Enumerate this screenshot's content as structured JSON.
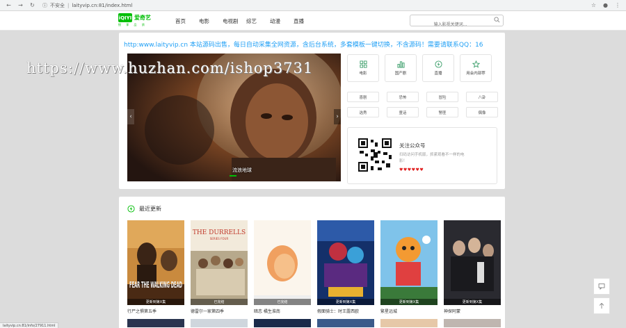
{
  "browser": {
    "insecure_label": "不安全",
    "separator": "|",
    "url": "laityvip.cn:81/index.html"
  },
  "header": {
    "logo_box": "iQIYI",
    "logo_text": "爱奇艺",
    "logo_sub": "悦 享 品 质",
    "nav": [
      "首页",
      "电影",
      "电视剧",
      "综艺",
      "动漫",
      "直播"
    ],
    "search_placeholder": "输入影视关键词...",
    "accent_color": "#00be06"
  },
  "marquee": "http:www.laityvip.cn 本站源码出售，每日自动采集全网资源，含后台系统，多套模板一键切换，不含源码！需要请联系QQ：16",
  "slider": {
    "title": "流浪地球"
  },
  "categories": [
    {
      "label": "电影",
      "icon": "grid-icon"
    },
    {
      "label": "国产剧",
      "icon": "bar-chart-icon"
    },
    {
      "label": "直播",
      "icon": "lightning-icon"
    },
    {
      "label": "用会内部荐",
      "icon": "star-icon"
    }
  ],
  "tags": [
    "喜剧",
    "恐怖",
    "冒险",
    "八卦",
    "选秀",
    "童话",
    "警匪",
    "偶像"
  ],
  "wechat": {
    "title": "关注公众号",
    "desc": "扫码访问手机版，抓紧观看不一样的电影！",
    "hearts": "♥♥♥♥♥♥"
  },
  "recent": {
    "title": "最近更新",
    "items": [
      {
        "name": "行尸之惧第五季",
        "badge": "更新到第X集"
      },
      {
        "name": "德雷尔一家第四季",
        "badge": "已完结"
      },
      {
        "name": "暗恋 橘生淮南",
        "badge": "已完结"
      },
      {
        "name": "假面骑士：时王露西欧",
        "badge": "更新到第X集"
      },
      {
        "name": "繁星远城",
        "badge": "更新到第X集"
      },
      {
        "name": "神探阿蒙",
        "badge": "更新到第X集"
      }
    ]
  },
  "poster_texts": {
    "durrells_title": "THE DURRELLS",
    "durrells_sub": "SERIES FOUR",
    "fear_title": "FEAR THE WALKING DEAD"
  },
  "watermark": "https://www.huzhan.com/ishop3731",
  "statusbar": "laityvip.cn:81/info/27911.html"
}
